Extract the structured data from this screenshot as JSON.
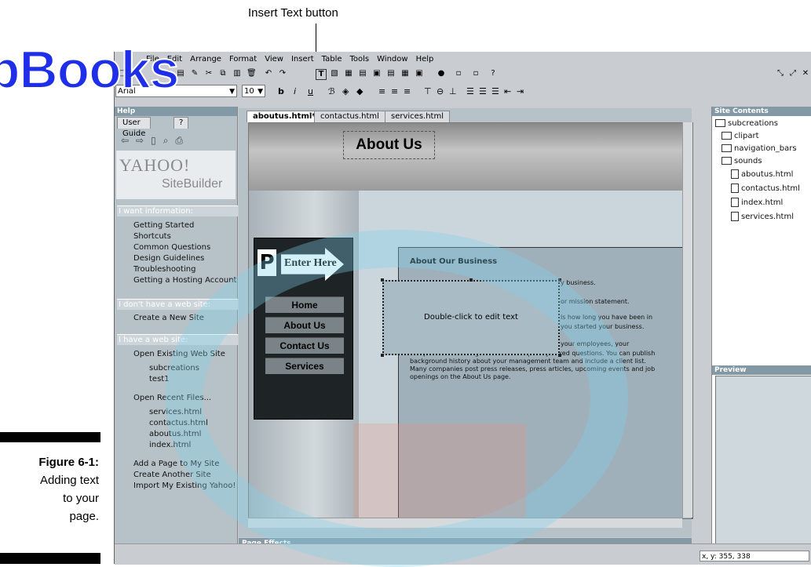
{
  "callout": {
    "label": "Insert Text button"
  },
  "watermark": {
    "text": "pBooks",
    "faint_text": "DropBooks"
  },
  "menubar": [
    "File",
    "Edit",
    "Arrange",
    "Format",
    "View",
    "Insert",
    "Table",
    "Tools",
    "Window",
    "Help"
  ],
  "format_toolbar": {
    "font": "Arial",
    "size": "10",
    "bold": "b",
    "italic": "i",
    "underline": "u"
  },
  "help_panel": {
    "title": "Help",
    "tabs": [
      "User Guide",
      "?"
    ],
    "logo_yahoo": "YAHOO!",
    "logo_product": "SiteBuilder",
    "sections": [
      {
        "header": "I want information:",
        "items": [
          "Getting Started",
          "Shortcuts",
          "Common Questions",
          "Design Guidelines",
          "Troubleshooting",
          "Getting a Hosting Account"
        ]
      },
      {
        "header": "I don't have a web site:",
        "items": [
          "Create a New Site"
        ]
      },
      {
        "header": "I have a web site:",
        "items": [
          "Open Existing Web Site",
          "subcreations",
          "test1",
          "Open Recent Files...",
          "services.html",
          "contactus.html",
          "aboutus.html",
          "index.html",
          "Add a Page to My Site",
          "Create Another Site",
          "Import My Existing Yahoo!"
        ]
      }
    ]
  },
  "doc_tabs": [
    "aboutus.html*",
    "contactus.html",
    "services.html"
  ],
  "page": {
    "heading": "About Us",
    "sign_letter": "P",
    "sign_text": "Enter Here",
    "nav": [
      "Home",
      "About Us",
      "Contact Us",
      "Services"
    ],
    "content_title": "About Our Business",
    "content_lines": [
      "y business.",
      "or mission statement.",
      "ls how long you have been in",
      "you started your business.",
      "your employees, your",
      "competitive advantage and other frequently asked questions. You can publish",
      "background history about your management team and include a client list.",
      "Many companies post press releases, press articles, upcoming events and job",
      "openings on the About Us page."
    ],
    "edit_hint": "Double-click to edit text"
  },
  "page_effects": "Page Effects",
  "site_contents": {
    "title": "Site Contents",
    "root": "subcreations",
    "folders": [
      "clipart",
      "navigation_bars",
      "sounds"
    ],
    "files": [
      "aboutus.html",
      "contactus.html",
      "index.html",
      "services.html"
    ]
  },
  "preview": {
    "title": "Preview"
  },
  "status": {
    "coords": "x, y: 355, 338"
  },
  "figure_caption": {
    "number": "Figure 6-1:",
    "line1": "Adding text",
    "line2": "to your",
    "line3": "page."
  }
}
